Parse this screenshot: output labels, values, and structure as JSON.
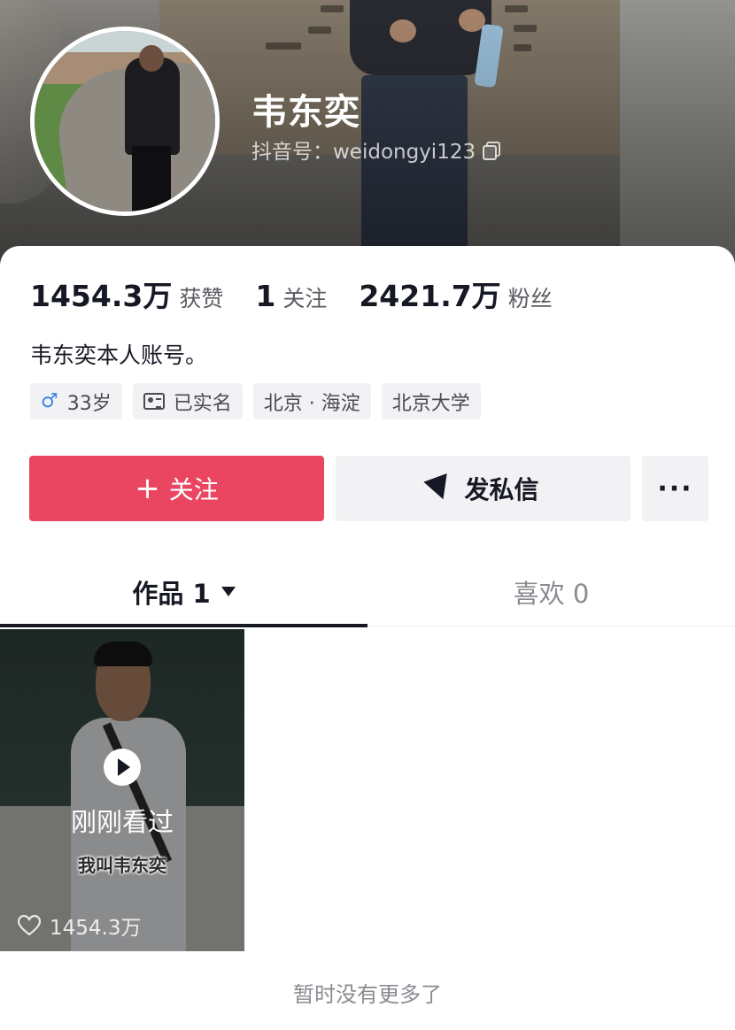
{
  "profile": {
    "name": "韦东奕",
    "douyin_id": "抖音号：weidongyi123"
  },
  "stats": [
    {
      "value": "1454.3万",
      "label": "获赞"
    },
    {
      "value": "1",
      "label": "关注"
    },
    {
      "value": "2421.7万",
      "label": "粉丝"
    }
  ],
  "bio": "韦东奕本人账号。",
  "tags": [
    {
      "icon": "male-icon",
      "text": "33岁"
    },
    {
      "icon": "id-card-icon",
      "text": "已实名"
    },
    {
      "text": "北京 · 海淀"
    },
    {
      "text": "北京大学"
    }
  ],
  "actions": {
    "follow_icon": "+",
    "follow_label": "关注",
    "message_label": "发私信",
    "more_label": "···"
  },
  "colors": {
    "follow_button": "#ea4662",
    "male_icon": "#3d86e8"
  },
  "tabs": [
    {
      "label": "作品 1",
      "active": true
    },
    {
      "label": "喜欢 0",
      "active": false
    }
  ],
  "videos": [
    {
      "overlay_text": "刚刚看过",
      "caption": "我叫韦东奕",
      "likes": "1454.3万"
    }
  ],
  "footer": "暂时没有更多了"
}
